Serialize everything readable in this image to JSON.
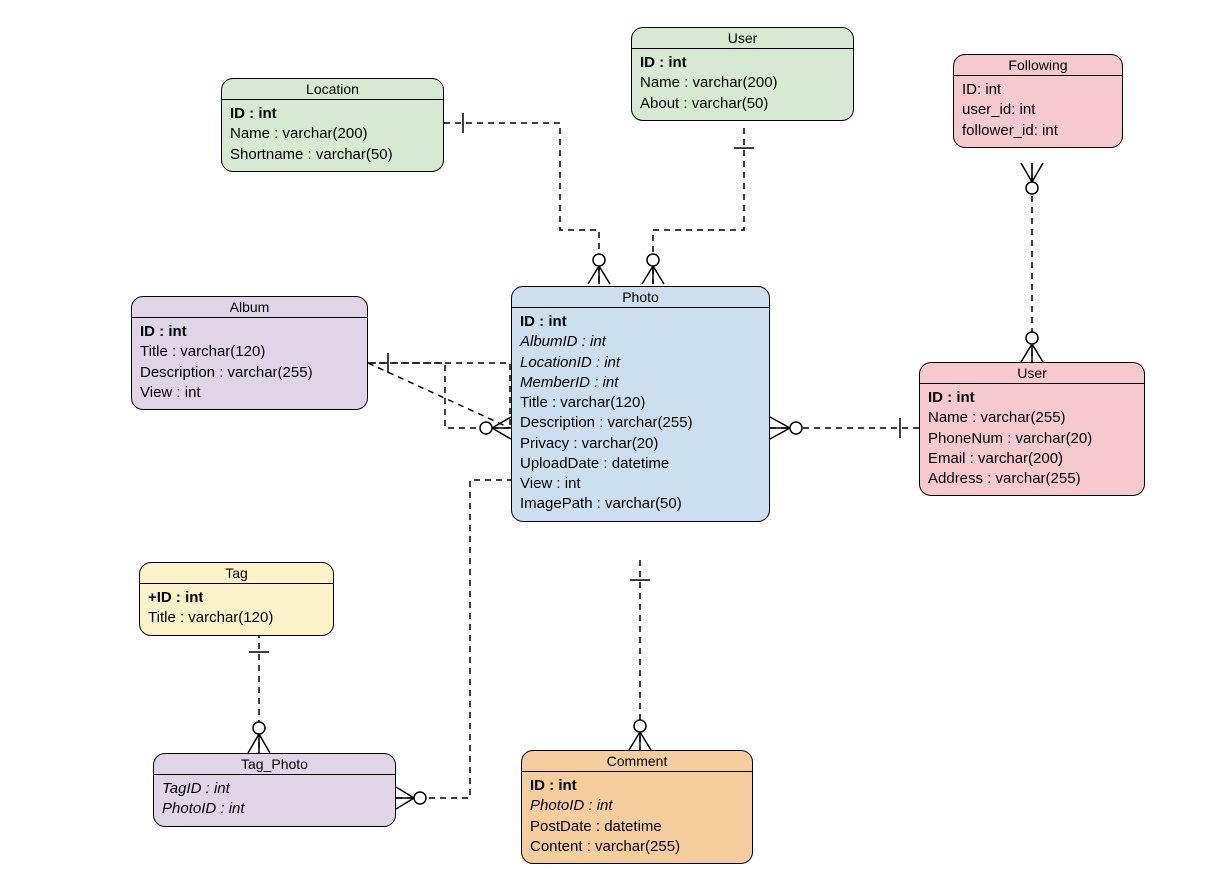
{
  "entities": {
    "location": {
      "title": "Location",
      "rows": [
        {
          "text": "ID : int",
          "bold": true
        },
        {
          "text": "Name : varchar(200)"
        },
        {
          "text": "Shortname : varchar(50)"
        }
      ]
    },
    "user_top": {
      "title": "User",
      "rows": [
        {
          "text": "ID : int",
          "bold": true
        },
        {
          "text": "Name : varchar(200)"
        },
        {
          "text": "About : varchar(50)"
        }
      ]
    },
    "following": {
      "title": "Following",
      "rows": [
        {
          "text": "ID: int"
        },
        {
          "text": "user_id: int"
        },
        {
          "text": "follower_id: int"
        }
      ]
    },
    "album": {
      "title": "Album",
      "rows": [
        {
          "text": "ID : int",
          "bold": true
        },
        {
          "text": "Title : varchar(120)"
        },
        {
          "text": "Description : varchar(255)"
        },
        {
          "text": "View : int"
        }
      ]
    },
    "photo": {
      "title": "Photo",
      "rows": [
        {
          "text": "ID : int",
          "bold": true
        },
        {
          "text": "AlbumID : int",
          "italic": true
        },
        {
          "text": "LocationID : int",
          "italic": true
        },
        {
          "text": "MemberID : int",
          "italic": true
        },
        {
          "text": "Title : varchar(120)"
        },
        {
          "text": "Description : varchar(255)"
        },
        {
          "text": "Privacy : varchar(20)"
        },
        {
          "text": "UploadDate : datetime"
        },
        {
          "text": "View : int"
        },
        {
          "text": "ImagePath : varchar(50)"
        }
      ]
    },
    "user_right": {
      "title": "User",
      "rows": [
        {
          "text": "ID : int",
          "bold": true
        },
        {
          "text": "Name : varchar(255)"
        },
        {
          "text": "PhoneNum : varchar(20)"
        },
        {
          "text": "Email : varchar(200)"
        },
        {
          "text": "Address : varchar(255)"
        }
      ]
    },
    "tag": {
      "title": "Tag",
      "rows": [
        {
          "text": "+ID : int",
          "bold": true
        },
        {
          "text": "Title : varchar(120)"
        }
      ]
    },
    "tag_photo": {
      "title": "Tag_Photo",
      "rows": [
        {
          "text": "TagID : int",
          "italic": true
        },
        {
          "text": "PhotoID : int",
          "italic": true
        }
      ]
    },
    "comment": {
      "title": "Comment",
      "rows": [
        {
          "text": "ID : int",
          "bold": true
        },
        {
          "text": "PhotoID : int",
          "italic": true
        },
        {
          "text": "PostDate : datetime"
        },
        {
          "text": "Content : varchar(255)"
        }
      ]
    }
  }
}
